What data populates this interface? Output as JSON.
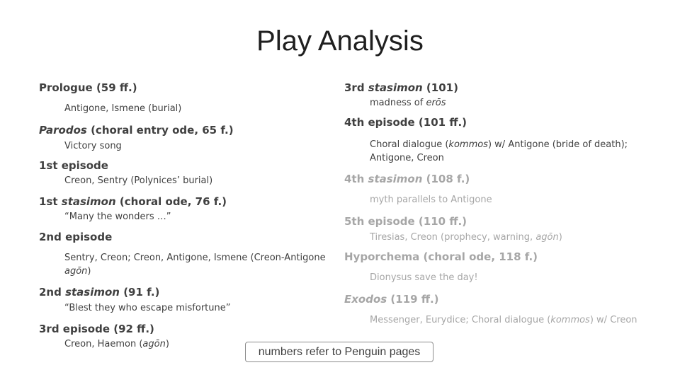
{
  "title": "Play Analysis",
  "left_column": [
    {
      "heading": {
        "pre": "Prologue (59 ff.)",
        "italic": "",
        "post": ""
      },
      "detail": {
        "pre": "Antigone, Ismene (burial)",
        "italic": "",
        "post": ""
      }
    },
    {
      "heading": {
        "pre": "",
        "italic": "Parodos",
        "post": " (choral entry ode, 65 f.)"
      },
      "detail": {
        "pre": "Victory song",
        "italic": "",
        "post": ""
      }
    },
    {
      "heading": {
        "pre": "1st episode",
        "italic": "",
        "post": ""
      },
      "detail": {
        "pre": "Creon, Sentry (Polynices’ burial)",
        "italic": "",
        "post": ""
      }
    },
    {
      "heading": {
        "pre": "1st ",
        "italic": "stasimon",
        "post": " (choral ode, 76 f.)"
      },
      "detail": {
        "pre": "“Many the wonders …”",
        "italic": "",
        "post": ""
      }
    },
    {
      "heading": {
        "pre": "2nd episode",
        "italic": "",
        "post": ""
      },
      "detail": {
        "pre": "Sentry, Creon; Creon, Antigone, Ismene (Creon-Antigone ",
        "italic": "agōn",
        "post": ")"
      }
    },
    {
      "heading": {
        "pre": "2nd ",
        "italic": "stasimon",
        "post": " (91 f.)"
      },
      "detail": {
        "pre": "“Blest they who escape misfortune”",
        "italic": "",
        "post": ""
      }
    },
    {
      "heading": {
        "pre": "3rd episode (92 ff.)",
        "italic": "",
        "post": ""
      },
      "detail": {
        "pre": "Creon, Haemon (",
        "italic": "agōn",
        "post": ")"
      }
    }
  ],
  "right_column": [
    {
      "dimmed": false,
      "heading": {
        "pre": "3rd ",
        "italic": "stasimon",
        "post": " (101)"
      },
      "detail": {
        "pre": "madness of ",
        "italic": "erōs",
        "post": ""
      }
    },
    {
      "dimmed": false,
      "heading": {
        "pre": "4th episode (101 ff.)",
        "italic": "",
        "post": ""
      },
      "detail": {
        "pre": "Choral dialogue (",
        "italic": "kommos",
        "post": ") w/ Antigone (bride of death); Antigone, Creon"
      }
    },
    {
      "dimmed": true,
      "heading": {
        "pre": "4th ",
        "italic": "stasimon",
        "post": " (108 f.)"
      },
      "detail": {
        "pre": "myth parallels to Antigone",
        "italic": "",
        "post": ""
      }
    },
    {
      "dimmed": true,
      "heading": {
        "pre": "5th episode (110 ff.)",
        "italic": "",
        "post": ""
      },
      "detail": {
        "pre": "Tiresias, Creon (prophecy, warning, ",
        "italic": "agōn",
        "post": ")"
      }
    },
    {
      "dimmed": true,
      "heading": {
        "pre": "Hyporchema (choral ode, 118 f.)",
        "italic": "",
        "post": ""
      },
      "detail": {
        "pre": "Dionysus save the day!",
        "italic": "",
        "post": ""
      }
    },
    {
      "dimmed": true,
      "heading": {
        "pre": "",
        "italic": "Exodos",
        "post": " (119 ff.)"
      },
      "detail": {
        "pre": "Messenger, Eurydice; Choral dialogue (",
        "italic": "kommos",
        "post": ") w/ Creon"
      }
    }
  ],
  "note": "numbers refer to Penguin pages",
  "colors": {
    "text": "#404040",
    "dimmed": "#a6a6a6",
    "title": "#1f1f1f"
  }
}
